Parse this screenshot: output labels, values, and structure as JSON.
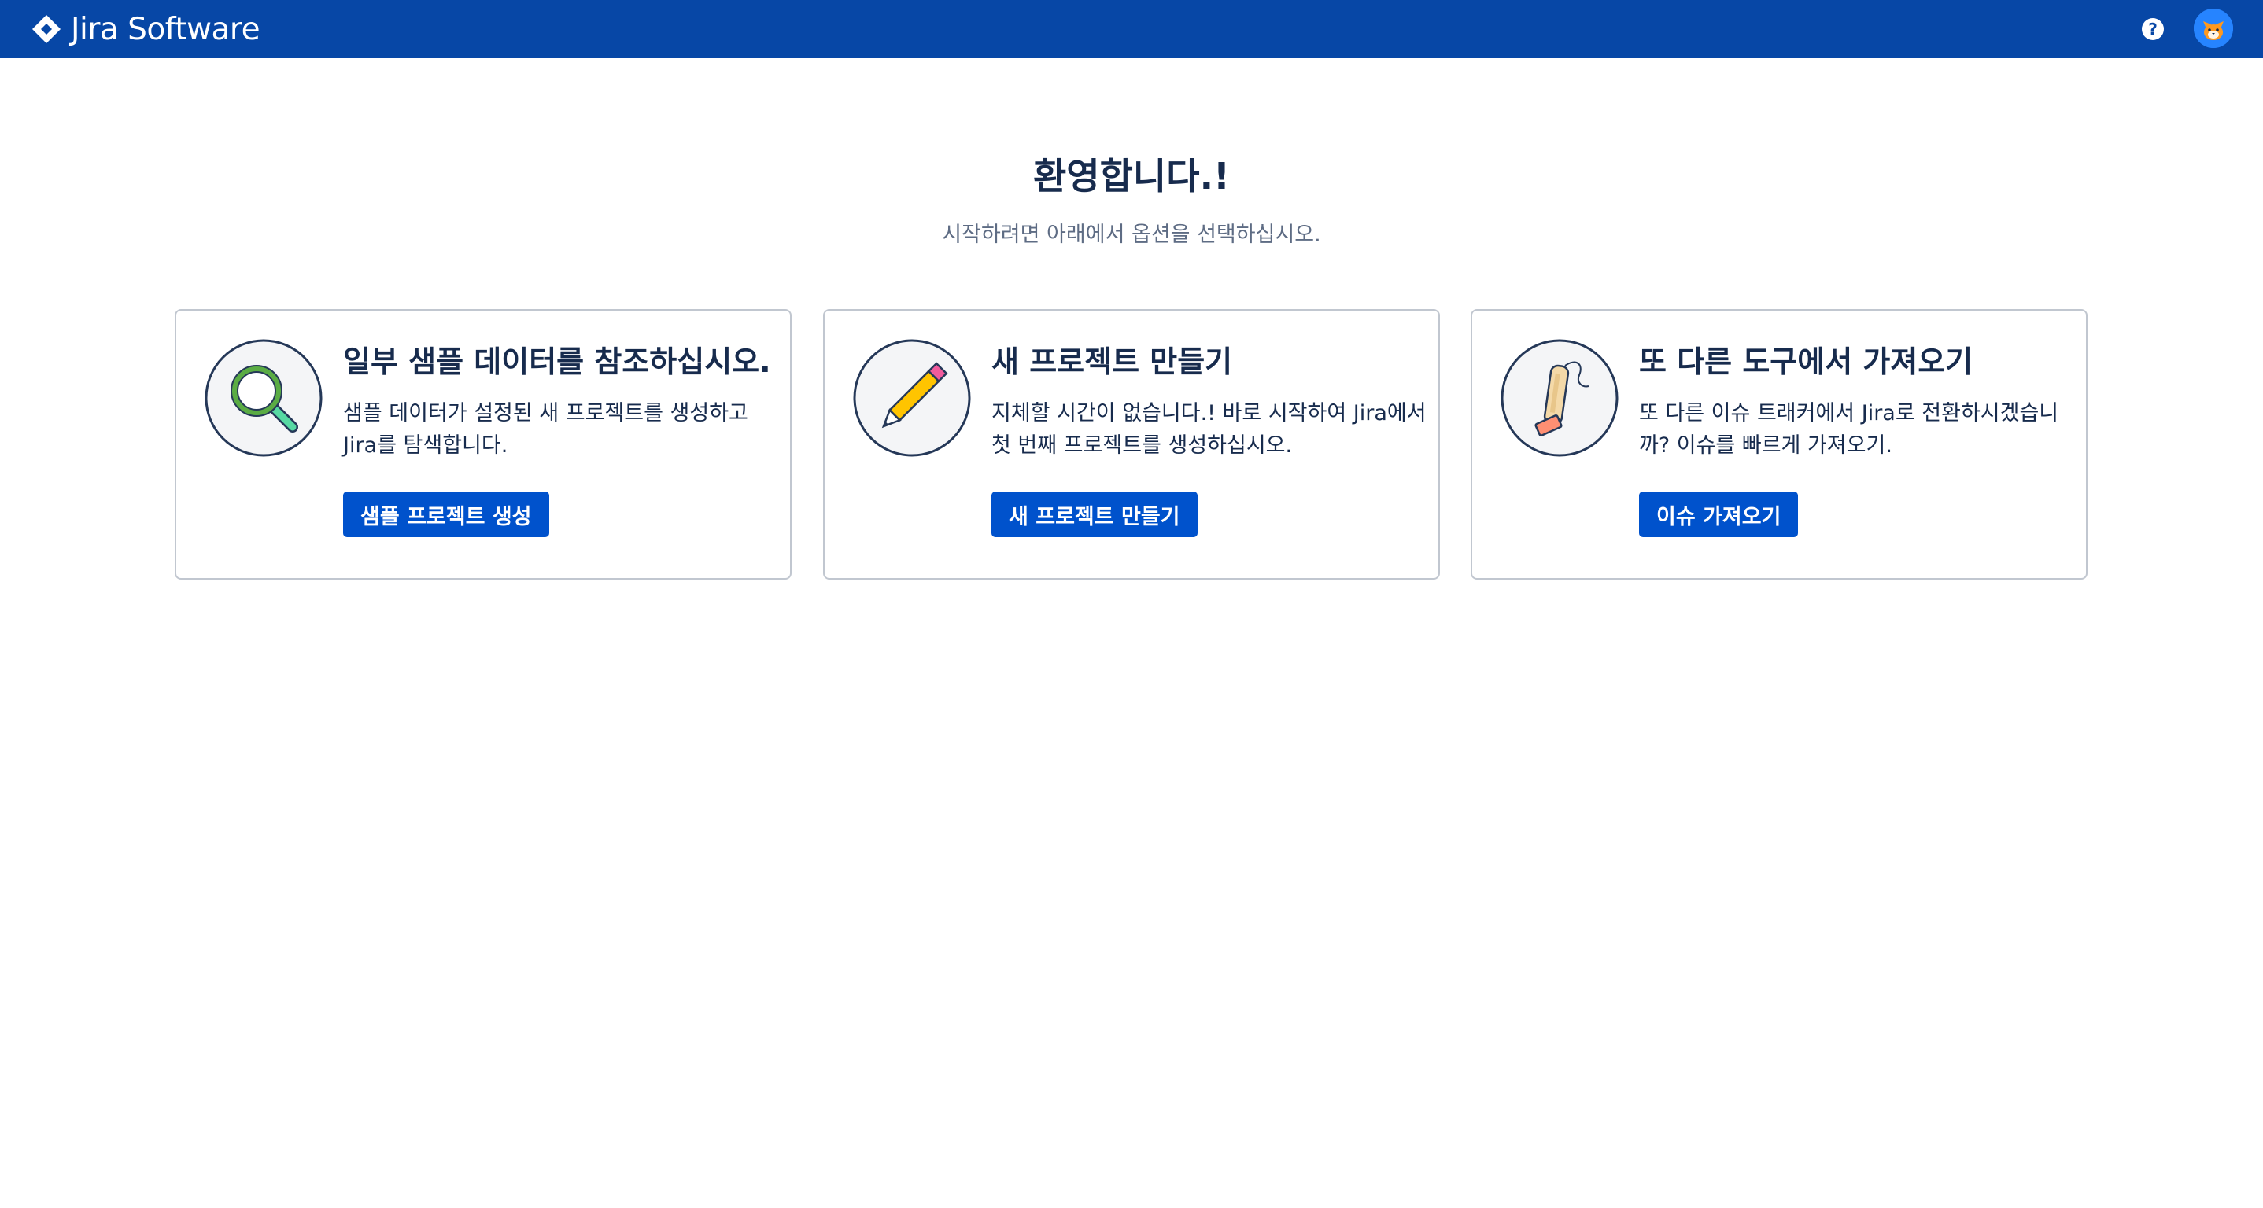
{
  "header": {
    "product_name": "Jira Software",
    "background_color": "#0747a6",
    "logo_icon": "jira-logo-icon",
    "help_icon": "help-icon",
    "avatar_icon": "user-avatar-cat"
  },
  "welcome": {
    "title": "환영합니다.!",
    "subtitle": "시작하려면 아래에서 옵션을 선택하십시오."
  },
  "cards": [
    {
      "icon": "magnifying-glass-icon",
      "title": "일부 샘플 데이터를 참조하십시오.",
      "description_line1": "샘플 데이터가 설정된 새 프로젝트를 생성하고",
      "description_line2": "Jira를 탐색합니다.",
      "button_label": "샘플 프로젝트 생성"
    },
    {
      "icon": "pencil-icon",
      "title": "새 프로젝트 만들기",
      "description_line1": "지체할 시간이 없습니다.! 바로 시작하여 Jira에서",
      "description_line2": "첫 번째 프로젝트를 생성하십시오.",
      "button_label": "새 프로젝트 만들기"
    },
    {
      "icon": "vacuum-import-icon",
      "title": "또 다른 도구에서 가져오기",
      "description_line1": "또 다른 이슈 트래커에서 Jira로 전환하시겠습니",
      "description_line2": "까? 이슈를 빠르게 가져오기.",
      "button_label": "이슈 가져오기"
    }
  ],
  "colors": {
    "primary_button": "#0052cc",
    "text_primary": "#172b4d",
    "text_secondary": "#5e6c84",
    "card_border": "#c1c7d0"
  }
}
